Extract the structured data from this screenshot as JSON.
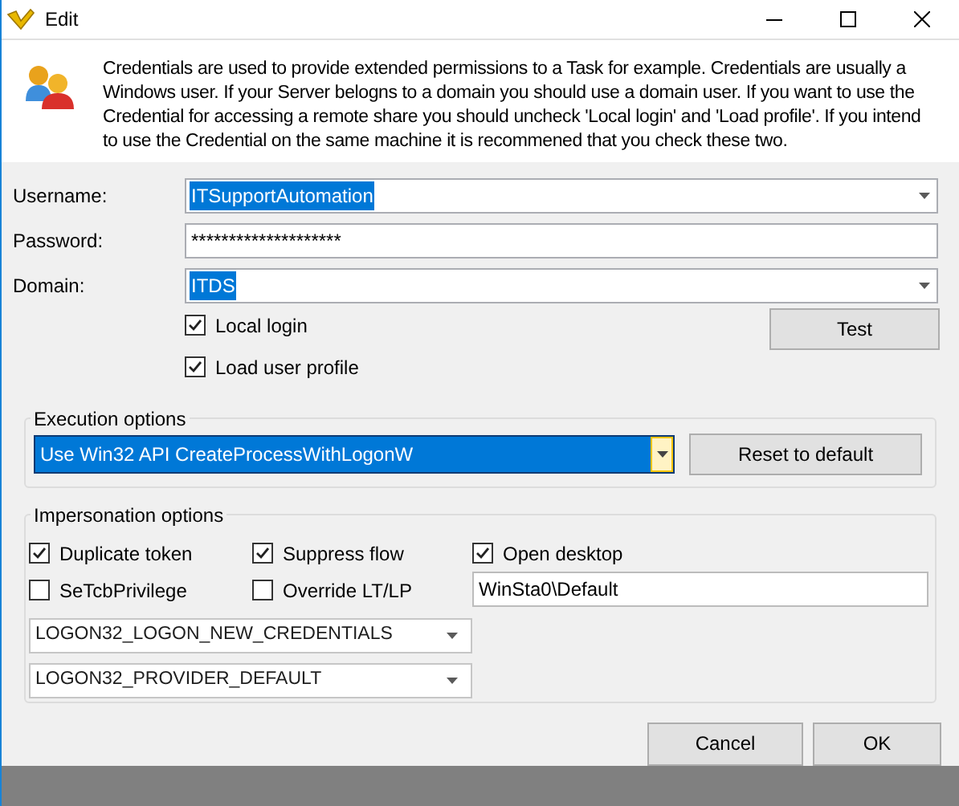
{
  "window": {
    "title": "Edit"
  },
  "info": "Credentials are used to provide extended permissions to a Task for example. Credentials are usually a Windows user. If your Server belogns to a domain you should use a domain user. If you want to use the Credential for accessing a remote share you should uncheck 'Local login' and 'Load profile'. If you intend to use the Credential on the same machine it is recommened that you check these two.",
  "fields": [
    {
      "label": "Username:",
      "kind": "combo",
      "value": "ITSupportAutomation",
      "selected": true
    },
    {
      "label": "Password:",
      "kind": "password",
      "value": "********************",
      "selected": false
    },
    {
      "label": "Domain:",
      "kind": "combo",
      "value": "ITDS",
      "selected": true
    }
  ],
  "login_options": [
    {
      "label": "Local login",
      "checked": true
    },
    {
      "label": "Load user profile",
      "checked": true
    }
  ],
  "test_button": "Test",
  "execution": {
    "title": "Execution options",
    "value": "Use Win32 API CreateProcessWithLogonW",
    "focused": true,
    "reset_button": "Reset to default"
  },
  "impersonation": {
    "title": "Impersonation options",
    "options": [
      {
        "label": "Duplicate token",
        "checked": true
      },
      {
        "label": "Suppress flow",
        "checked": true
      },
      {
        "label": "Open desktop",
        "checked": true
      },
      {
        "label": "SeTcbPrivilege",
        "checked": false
      },
      {
        "label": "Override LT/LP",
        "checked": false
      }
    ],
    "desktop": "WinSta0\\Default",
    "dropdowns": [
      "LOGON32_LOGON_NEW_CREDENTIALS",
      "LOGON32_PROVIDER_DEFAULT"
    ]
  },
  "buttons": [
    "Cancel",
    "OK"
  ]
}
